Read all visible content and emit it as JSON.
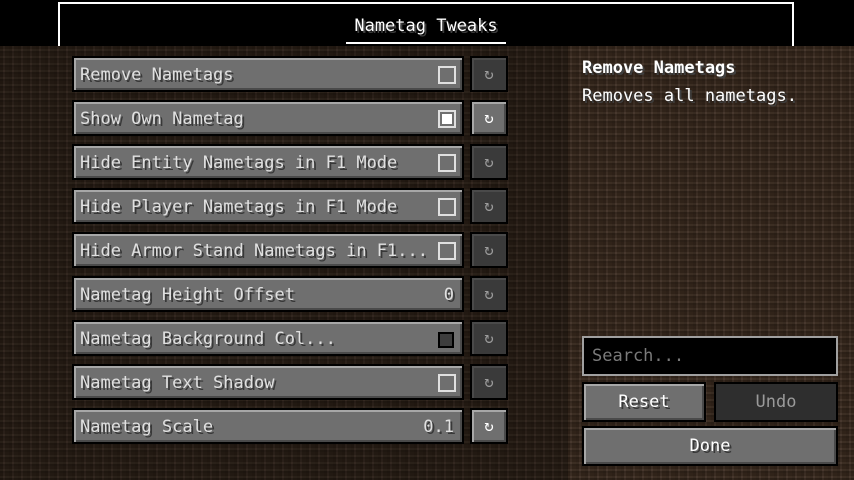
{
  "window": {
    "title": "Nametag Tweaks"
  },
  "options": [
    {
      "label": "Remove Nametags",
      "control": "checkbox",
      "checked": false,
      "reset_enabled": false
    },
    {
      "label": "Show Own Nametag",
      "control": "checkbox",
      "checked": true,
      "reset_enabled": true
    },
    {
      "label": "Hide Entity Nametags in F1 Mode",
      "control": "checkbox",
      "checked": false,
      "reset_enabled": false
    },
    {
      "label": "Hide Player Nametags in F1 Mode",
      "control": "checkbox",
      "checked": false,
      "reset_enabled": false
    },
    {
      "label": "Hide Armor Stand Nametags in F1...",
      "control": "checkbox",
      "checked": false,
      "reset_enabled": false
    },
    {
      "label": "Nametag Height Offset",
      "control": "number",
      "value": "0",
      "reset_enabled": false
    },
    {
      "label": "Nametag Background Col...",
      "control": "color",
      "color": "#3d3d3d",
      "reset_enabled": false
    },
    {
      "label": "Nametag Text Shadow",
      "control": "checkbox",
      "checked": false,
      "reset_enabled": false
    },
    {
      "label": "Nametag Scale",
      "control": "number",
      "value": "0.1",
      "reset_enabled": true
    }
  ],
  "reset_icon": "↻",
  "description": {
    "title": "Remove Nametags",
    "text": "Removes all nametags."
  },
  "search": {
    "placeholder": "Search...",
    "value": ""
  },
  "buttons": {
    "reset": "Reset",
    "undo": "Undo",
    "done": "Done"
  },
  "colors": {
    "button_face": "#6f6f6f",
    "disabled_button": "#2e2e2e",
    "text": "#e0e0e0",
    "background": "#3a2a1e"
  }
}
